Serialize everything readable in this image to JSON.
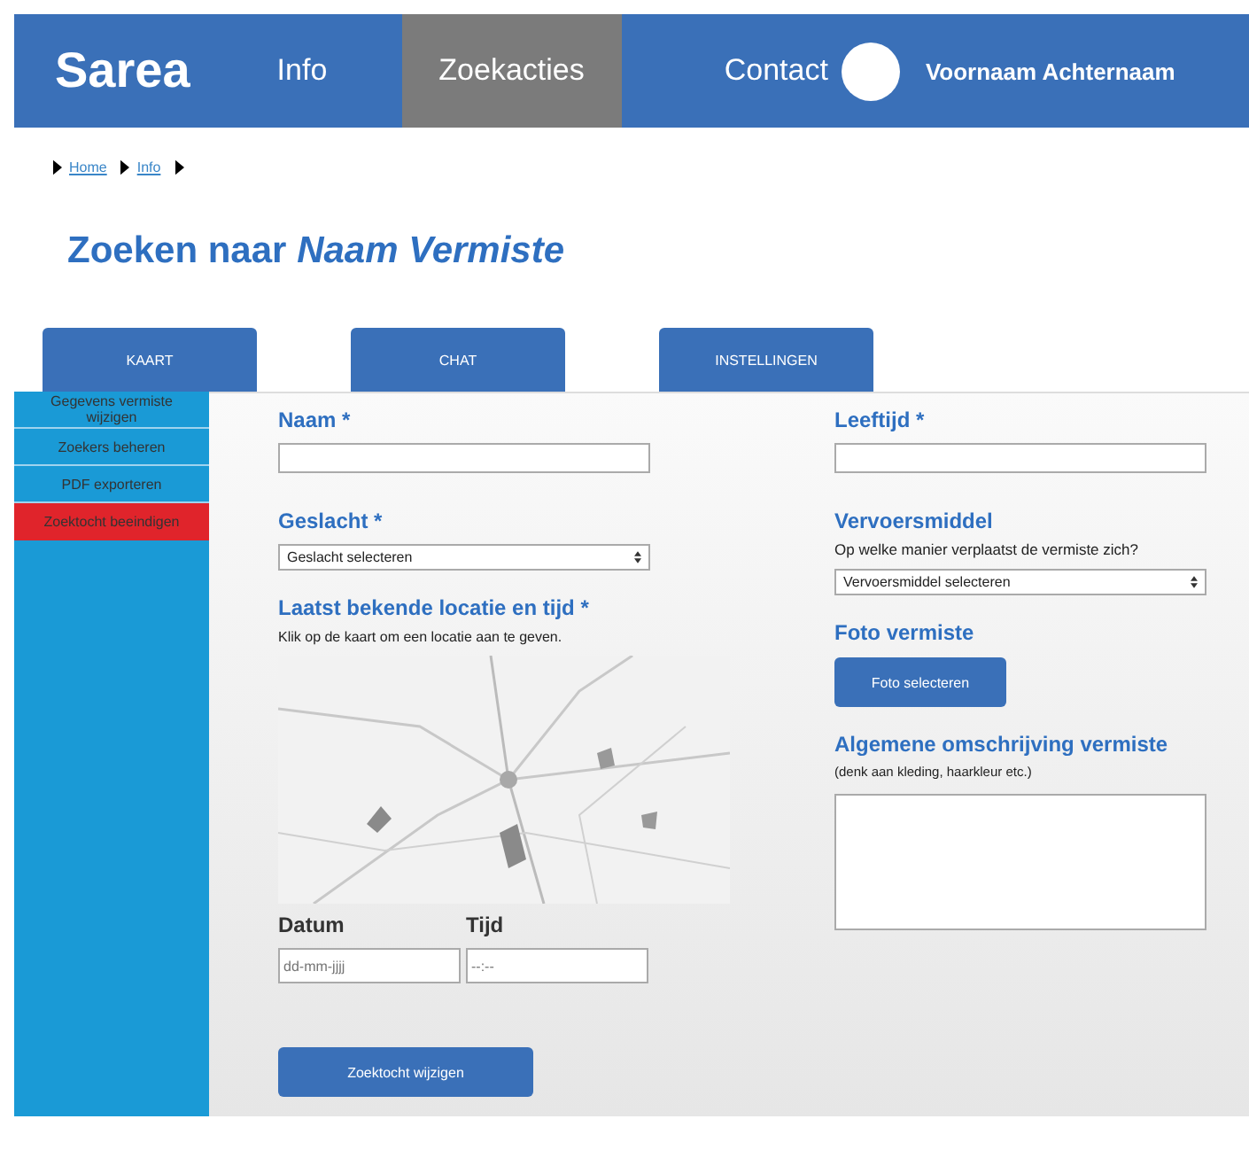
{
  "header": {
    "logo": "Sarea",
    "nav": [
      {
        "label": "Info",
        "selected": false
      },
      {
        "label": "Zoekacties",
        "selected": true
      },
      {
        "label": "Contact",
        "selected": false
      }
    ],
    "user": "Voornaam Achternaam"
  },
  "breadcrumb": [
    {
      "label": "Home"
    },
    {
      "label": "Info"
    }
  ],
  "title": "Zoeken naar *Naam Vermiste*",
  "tabs": [
    {
      "label": "KAART"
    },
    {
      "label": "CHAT"
    },
    {
      "label": "INSTELLINGEN"
    }
  ],
  "sidebar": {
    "items": [
      {
        "label": "Gegevens vermiste wijzigen",
        "kind": "normal"
      },
      {
        "label": "Zoekers beheren",
        "kind": "normal"
      },
      {
        "label": "PDF exporteren",
        "kind": "normal"
      },
      {
        "label": "Zoektocht beeindigen",
        "kind": "danger"
      }
    ]
  },
  "form": {
    "name_label": "Naam *",
    "gender_label": "Geslacht *",
    "gender_select": "Geslacht selecteren",
    "location_label": "Laatst bekende locatie en tijd *",
    "location_hint": "Klik op de kaart om een locatie aan te geven.",
    "date_label": "Datum",
    "date_placeholder": "dd-mm-jjjj",
    "time_label": "Tijd",
    "time_placeholder": "--:--",
    "submit": "Zoektocht wijzigen",
    "age_label": "Leeftijd *",
    "transport_label": "Vervoersmiddel",
    "transport_hint": "Op welke manier verplaatst de vermiste zich?",
    "transport_select": "Vervoersmiddel selecteren",
    "photo_label": "Foto vermiste",
    "photo_button": "Foto selecteren",
    "description_label": "Algemene omschrijving vermiste",
    "description_hint": "(denk aan kleding, haarkleur etc.)"
  }
}
